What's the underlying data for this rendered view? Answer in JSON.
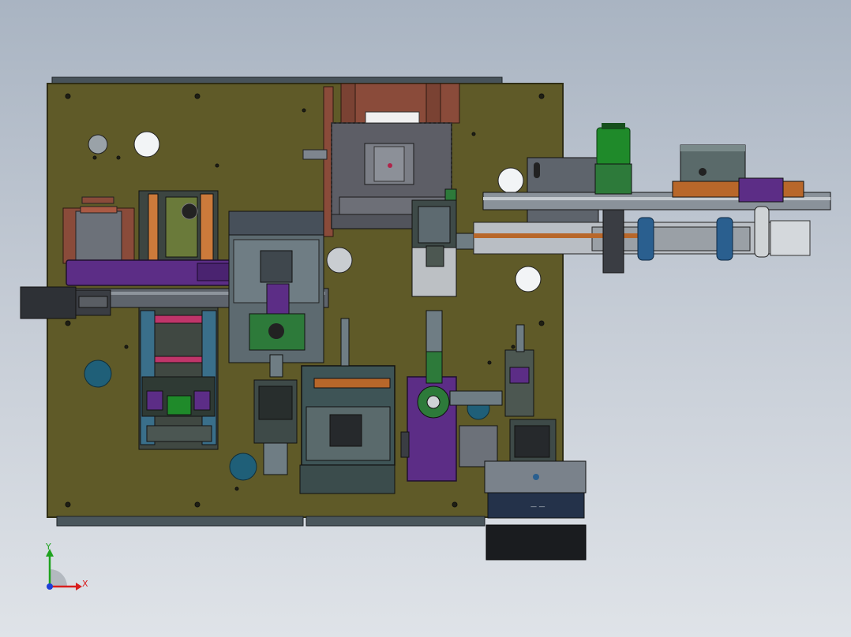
{
  "viewport": {
    "background_top": "#a9b4c2",
    "background_bottom": "#dfe3e8"
  },
  "colors": {
    "base_plate": "#5f5a28",
    "base_plate_edge": "#2f2d14",
    "frame_dark": "#3e4a48",
    "steel_gray": "#7d8590",
    "dark_block": "#4a4e55",
    "rust_plate": "#8a4b3a",
    "purple_part": "#5c2d86",
    "motor_green": "#1f8a2a",
    "teal_hole": "#1f5f78",
    "orange_rail": "#b8672a",
    "blue_roller": "#2a5f8f",
    "conveyor_silver": "#b9bec4"
  },
  "triad": {
    "x_label": "X",
    "y_label": "Y",
    "x_color": "#d81e1e",
    "y_color": "#1fa31f",
    "z_color": "#1e3fd8"
  },
  "panel_label": "— —"
}
